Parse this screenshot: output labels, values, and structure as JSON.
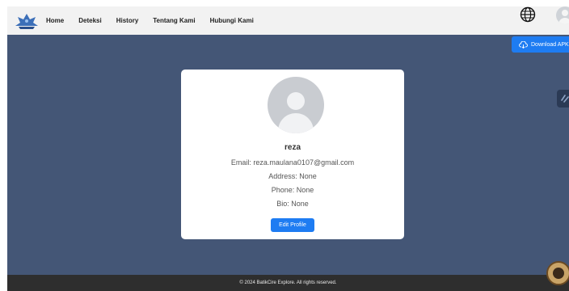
{
  "navbar": {
    "links": [
      "Home",
      "Deteksi",
      "History",
      "Tentang Kami",
      "Hubungi Kami"
    ]
  },
  "download": {
    "label": "Download APK"
  },
  "profile": {
    "name": "reza",
    "email": "Email: reza.maulana0107@gmail.com",
    "address": "Address: None",
    "phone": "Phone: None",
    "bio": "Bio: None",
    "edit_label": "Edit Profile"
  },
  "footer": {
    "text": "© 2024 BatikCire Explore. All rights reserved."
  },
  "icons": {
    "logo": "batik-logo-icon",
    "globe": "globe-icon",
    "avatar": "user-avatar-icon",
    "cloud": "cloud-download-icon",
    "side": "sidebar-toggle-icon",
    "badge": "chatbot-badge-icon"
  },
  "colors": {
    "background": "#445676",
    "primary": "#1e7cf2",
    "navbar": "#f2f2f2",
    "footer": "#2e2e2e"
  }
}
